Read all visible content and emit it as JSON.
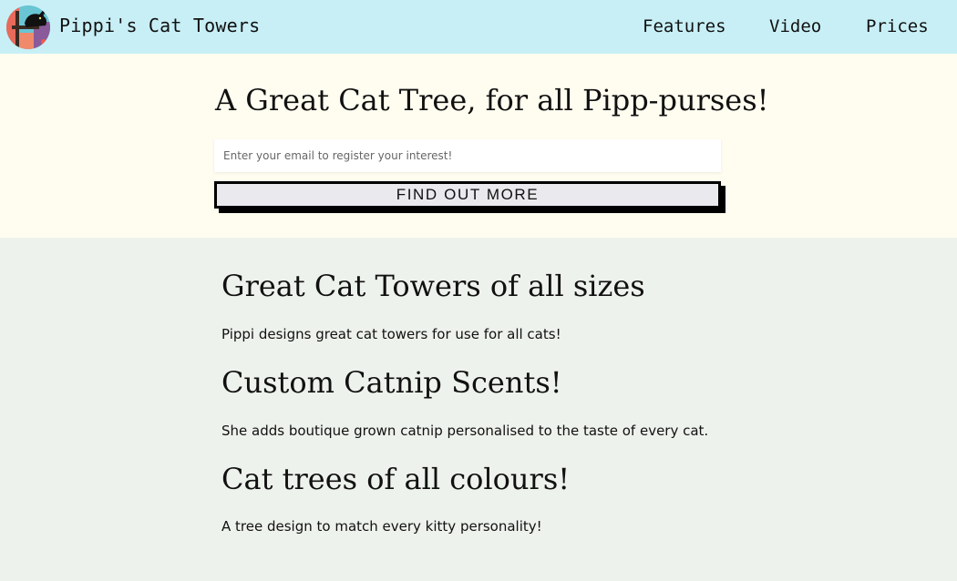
{
  "header": {
    "brand": "Pippi's Cat Towers",
    "logo_icon": "cat-tower-logo-icon",
    "nav": [
      {
        "label": "Features"
      },
      {
        "label": "Video"
      },
      {
        "label": "Prices"
      }
    ],
    "colors": {
      "background": "#c8eff6"
    }
  },
  "hero": {
    "title": "A Great Cat Tree, for all Pipp-purses!",
    "email_placeholder": "Enter your email to register your interest!",
    "email_value": "",
    "cta_label": "FIND OUT MORE",
    "colors": {
      "background": "#fffdef",
      "button": "#e9e9ee",
      "button_border": "#000000"
    }
  },
  "features": [
    {
      "title": "Great Cat Towers of all sizes",
      "text": "Pippi designs great cat towers for use for all cats!"
    },
    {
      "title": "Custom Catnip Scents!",
      "text": "She adds boutique grown catnip personalised to the taste of every cat."
    },
    {
      "title": "Cat trees of all colours!",
      "text": "A tree design to match every kitty personality!"
    }
  ],
  "colors": {
    "page_background": "#eef2ec"
  }
}
